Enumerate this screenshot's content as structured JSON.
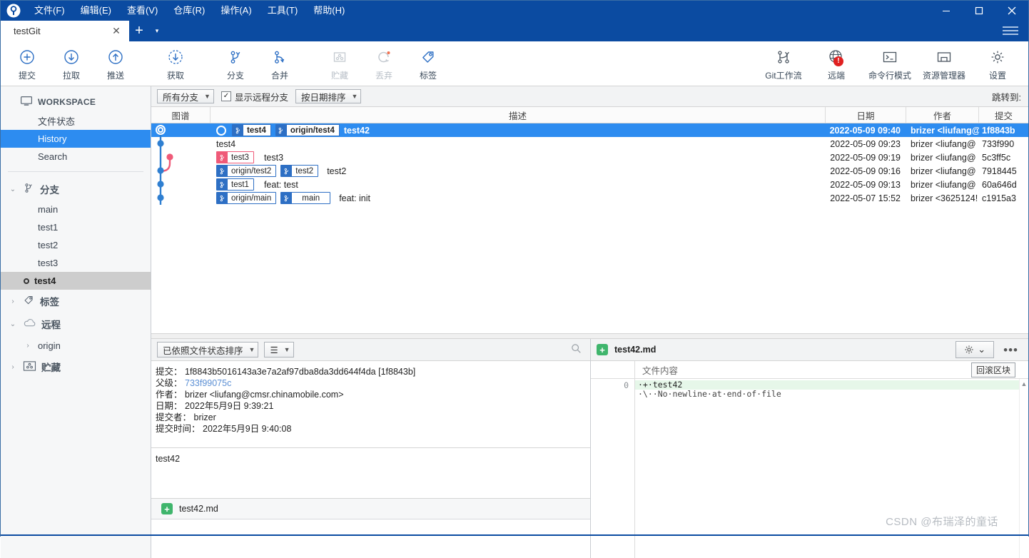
{
  "window": {
    "app_icon": "sourcetree-logo-icon",
    "menus": [
      "文件(F)",
      "编辑(E)",
      "查看(V)",
      "仓库(R)",
      "操作(A)",
      "工具(T)",
      "帮助(H)"
    ],
    "controls": {
      "minimize": "—",
      "maximize": "▢",
      "close": "✕"
    },
    "hamburger": "hamburger-icon"
  },
  "tabs": {
    "items": [
      {
        "label": "testGit",
        "close": "✕"
      }
    ],
    "new_tab": "+",
    "tab_dropdown": "▾"
  },
  "toolbar": {
    "left": [
      {
        "label": "提交",
        "icon": "commit-plus-icon",
        "disabled": false
      },
      {
        "label": "拉取",
        "icon": "pull-down-arrow-icon",
        "disabled": false
      },
      {
        "label": "推送",
        "icon": "push-up-arrow-icon",
        "disabled": false
      },
      {
        "label": "获取",
        "icon": "fetch-dashed-arrow-icon",
        "disabled": false
      },
      {
        "label": "分支",
        "icon": "branch-icon",
        "disabled": false
      },
      {
        "label": "合并",
        "icon": "merge-icon",
        "disabled": false
      },
      {
        "label": "贮藏",
        "icon": "stash-icon",
        "disabled": true
      },
      {
        "label": "丢弃",
        "icon": "discard-refresh-icon",
        "disabled": true
      },
      {
        "label": "标签",
        "icon": "tag-icon",
        "disabled": false
      }
    ],
    "right": [
      {
        "label": "Git工作流",
        "icon": "gitflow-icon",
        "badge": ""
      },
      {
        "label": "远端",
        "icon": "globe-remote-icon",
        "badge": "!"
      },
      {
        "label": "命令行模式",
        "icon": "terminal-icon",
        "badge": ""
      },
      {
        "label": "资源管理器",
        "icon": "folder-explorer-icon",
        "badge": ""
      },
      {
        "label": "设置",
        "icon": "gear-settings-icon",
        "badge": ""
      }
    ]
  },
  "sidebar": {
    "workspace": {
      "label": "WORKSPACE",
      "icon": "monitor-icon"
    },
    "workspace_items": [
      {
        "label": "文件状态",
        "selected": false
      },
      {
        "label": "History",
        "selected": true
      },
      {
        "label": "Search",
        "selected": false
      }
    ],
    "groups": [
      {
        "label": "分支",
        "icon": "branch-icon",
        "caret": "⌄",
        "expanded": true,
        "items": [
          {
            "label": "main",
            "current": false
          },
          {
            "label": "test1",
            "current": false
          },
          {
            "label": "test2",
            "current": false
          },
          {
            "label": "test3",
            "current": false
          },
          {
            "label": "test4",
            "current": true
          }
        ]
      },
      {
        "label": "标签",
        "icon": "tag-icon",
        "caret": "›",
        "expanded": false,
        "items": []
      },
      {
        "label": "远程",
        "icon": "cloud-icon",
        "caret": "⌄",
        "expanded": true,
        "items": [
          {
            "label": "origin",
            "caret": "›"
          }
        ]
      },
      {
        "label": "贮藏",
        "icon": "stash-icon",
        "caret": "›",
        "expanded": false,
        "items": []
      }
    ]
  },
  "history": {
    "filters": {
      "branch_select": "所有分支",
      "show_remote_label": "显示远程分支",
      "show_remote_checked": true,
      "sort_select": "按日期排序"
    },
    "jump_to_label": "跳转到:",
    "columns": [
      "图谱",
      "描述",
      "日期",
      "作者",
      "提交"
    ],
    "rows": [
      {
        "refs": [
          {
            "name": "test4",
            "color": "blue"
          },
          {
            "name": "origin/test4",
            "color": "blue"
          }
        ],
        "message": "test42",
        "date": "2022-05-09 09:40",
        "author": "brizer <liufang@",
        "commit": "1f8843b",
        "selected": true,
        "node": "ring"
      },
      {
        "refs": [],
        "message": "test4",
        "date": "2022-05-09 09:23",
        "author": "brizer <liufang@",
        "commit": "733f990",
        "selected": false,
        "node": "dot"
      },
      {
        "refs": [
          {
            "name": "test3",
            "color": "pink"
          }
        ],
        "message": "test3",
        "date": "2022-05-09 09:19",
        "author": "brizer <liufang@",
        "commit": "5c3ff5c",
        "selected": false,
        "node": "pink-dot"
      },
      {
        "refs": [
          {
            "name": "origin/test2",
            "color": "blue"
          },
          {
            "name": "test2",
            "color": "blue"
          }
        ],
        "message": "test2",
        "date": "2022-05-09 09:16",
        "author": "brizer <liufang@",
        "commit": "7918445",
        "selected": false,
        "node": "dot"
      },
      {
        "refs": [
          {
            "name": "test1",
            "color": "blue"
          }
        ],
        "message": "feat: test",
        "date": "2022-05-09 09:13",
        "author": "brizer <liufang@",
        "commit": "60a646d",
        "selected": false,
        "node": "dot"
      },
      {
        "refs": [
          {
            "name": "origin/main",
            "color": "blue"
          },
          {
            "name": "main",
            "color": "blue"
          }
        ],
        "message": "feat: init",
        "date": "2022-05-07 15:52",
        "author": "brizer <3625124!",
        "commit": "c1915a3",
        "selected": false,
        "node": "dot"
      }
    ]
  },
  "details": {
    "sort_select": "已依照文件状态排序",
    "view_button": "☰",
    "search_icon": "search-icon",
    "fields": [
      {
        "label": "提交：",
        "value": "1f8843b5016143a3e7a2af97dba8da3dd644f4da [1f8843b]",
        "link": false
      },
      {
        "label": "父级：",
        "value": "733f99075c",
        "link": true
      },
      {
        "label": "作者：",
        "value": "brizer <liufang@cmsr.chinamobile.com>",
        "link": false
      },
      {
        "label": "日期：",
        "value": "2022年5月9日 9:39:21",
        "link": false
      },
      {
        "label": "提交者：",
        "value": "brizer",
        "link": false
      },
      {
        "label": "提交时间：",
        "value": "2022年5月9日 9:40:08",
        "link": false
      }
    ],
    "commit_message": "test42",
    "files": [
      {
        "name": "test42.md",
        "status": "added"
      }
    ]
  },
  "diff": {
    "file_name": "test42.md",
    "file_status": "added",
    "gear_icon": "gear-icon",
    "gear_caret": "⌄",
    "more_icon": "more-dots-icon",
    "content_header": "文件内容",
    "rollback_button": "回滚区块",
    "line_numbers": [
      "0"
    ],
    "lines": [
      {
        "text": "·+·test42",
        "type": "add"
      },
      {
        "text": "·\\··No·newline·at·end·of·file",
        "type": "meta"
      }
    ]
  },
  "watermark": "CSDN @布瑞泽的童话",
  "colors": {
    "titlebar": "#0b4ba1",
    "accent_blue": "#2d8cf0",
    "ref_blue": "#2d6fc4",
    "ref_pink": "#ef5a78",
    "added_green": "#3fb56c",
    "diff_add_bg": "#e6f7e9",
    "badge_red": "#e02020"
  }
}
